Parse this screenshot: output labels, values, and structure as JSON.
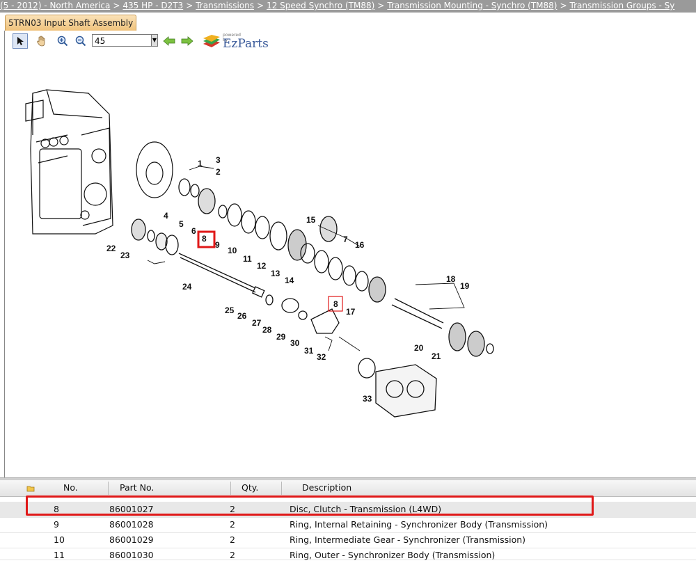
{
  "breadcrumb": {
    "items": [
      "(5 - 2012) - North America",
      "435 HP - D2T3",
      "Transmissions",
      "12 Speed Synchro (TM88)",
      "Transmission Mounting - Synchro (TM88)",
      "Transmission Groups - Sy"
    ],
    "separator": ">"
  },
  "tab": {
    "label": "5TRN03 Input Shaft Assembly"
  },
  "toolbar": {
    "zoom_value": "45",
    "logo_powered": "powered by",
    "logo_name": "EzParts"
  },
  "diagram": {
    "callouts": [
      "1",
      "2",
      "3",
      "4",
      "5",
      "6",
      "7",
      "8",
      "9",
      "10",
      "11",
      "12",
      "13",
      "14",
      "15",
      "16",
      "17",
      "18",
      "19",
      "20",
      "21",
      "22",
      "23",
      "24",
      "25",
      "26",
      "27",
      "28",
      "29",
      "30",
      "31",
      "32",
      "33"
    ],
    "highlighted_callout": "8"
  },
  "table": {
    "columns": [
      "",
      "No.",
      "Part No.",
      "Qty.",
      "Description"
    ],
    "rows": [
      {
        "no": "8",
        "part": "86001027",
        "qty": "2",
        "desc": "Disc, Clutch - Transmission (L4WD)"
      },
      {
        "no": "9",
        "part": "86001028",
        "qty": "2",
        "desc": "Ring, Internal Retaining - Synchronizer Body (Transmission)"
      },
      {
        "no": "10",
        "part": "86001029",
        "qty": "2",
        "desc": "Ring, Intermediate Gear - Synchronizer (Transmission)"
      },
      {
        "no": "11",
        "part": "86001030",
        "qty": "2",
        "desc": "Ring, Outer - Synchronizer Body (Transmission)"
      }
    ]
  },
  "colors": {
    "highlight": "#e01818",
    "breadcrumb_bg": "#9a9a9a",
    "tab_bg": "#efc27b"
  }
}
